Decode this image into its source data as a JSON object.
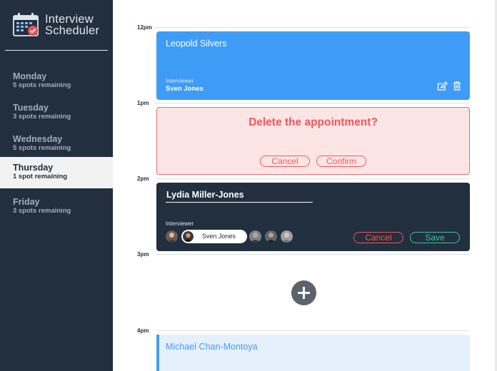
{
  "app": {
    "title_line1": "Interview",
    "title_line2": "Scheduler"
  },
  "colors": {
    "sidebar": "#222f3e",
    "accent_blue": "#3e9cf7",
    "danger": "#f15858",
    "success": "#3fc2a0"
  },
  "days": [
    {
      "name": "Monday",
      "spots": "5 spots remaining",
      "selected": false
    },
    {
      "name": "Tuesday",
      "spots": "3 spots remaining",
      "selected": false
    },
    {
      "name": "Wednesday",
      "spots": "5 spots remaining",
      "selected": false
    },
    {
      "name": "Thursday",
      "spots": "1 spot remaining",
      "selected": true
    },
    {
      "name": "Friday",
      "spots": "3 spots remaining",
      "selected": false
    }
  ],
  "times": [
    "12pm",
    "1pm",
    "2pm",
    "3pm",
    "4pm"
  ],
  "appointments": {
    "first": {
      "student": "Leopold Silvers",
      "interviewer_label": "Interviewer",
      "interviewer": "Sven Jones",
      "icons": [
        "edit-icon",
        "trash-icon"
      ]
    },
    "confirm": {
      "message": "Delete the appointment?",
      "cancel": "Cancel",
      "confirm": "Confirm"
    },
    "form": {
      "student_value": "Lydia Miller-Jones",
      "interviewer_label": "Interviewer",
      "selected_interviewer": "Sven Jones",
      "cancel": "Cancel",
      "save": "Save"
    },
    "last": {
      "student": "Michael Chan-Montoya"
    }
  },
  "add_icon": "plus-circle-icon"
}
